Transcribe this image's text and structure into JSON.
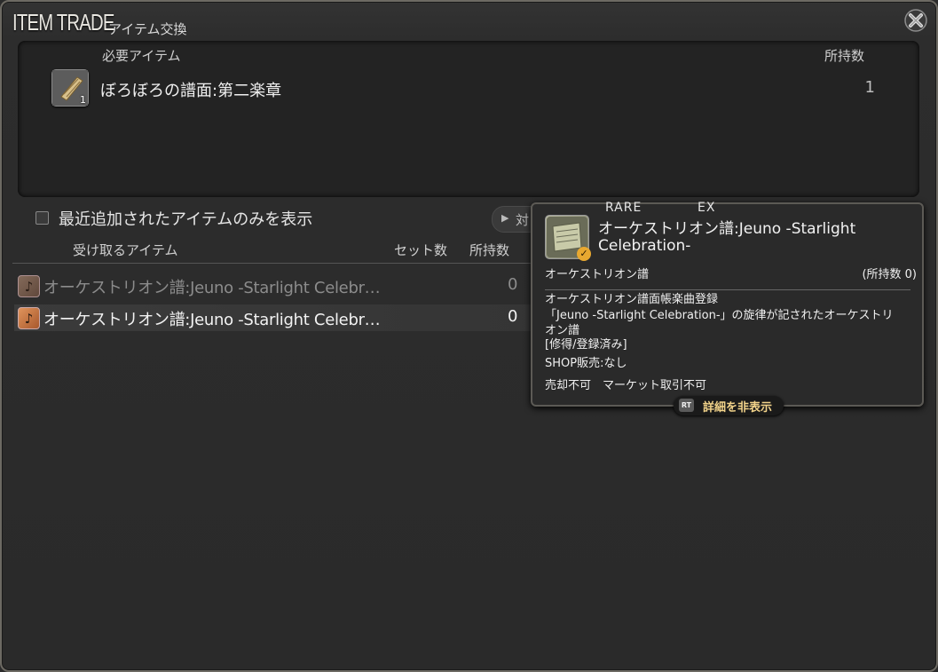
{
  "window": {
    "title": "ITEM TRADE",
    "subtitle": "アイテム交換"
  },
  "required": {
    "header_item": "必要アイテム",
    "header_owned": "所持数",
    "item": {
      "name": "ぼろぼろの譜面:第二楽章",
      "qty": "1",
      "owned": "1",
      "icon": "scroll-icon"
    }
  },
  "filter": {
    "checkbox_label": "最近追加されたアイテムのみを表示",
    "button_label": "対",
    "checked": false
  },
  "list": {
    "header_item": "受け取るアイテム",
    "header_set": "セット数",
    "header_owned": "所持数",
    "rows": [
      {
        "name": "オーケストリオン譜:Jeuno -Starlight Celebr…",
        "owned": "0",
        "icon": "music-note-icon"
      },
      {
        "name": "オーケストリオン譜:Jeuno -Starlight Celebr…",
        "owned": "0",
        "icon": "music-note-icon"
      }
    ]
  },
  "tooltip": {
    "tag_rare": "RARE",
    "tag_ex": "EX",
    "name": "オーケストリオン譜:Jeuno -Starlight Celebration-",
    "category": "オーケストリオン譜",
    "owned": "(所持数 0)",
    "desc_line1": "オーケストリオン譜面帳楽曲登録",
    "desc_line2": "「Jeuno -Starlight Celebration-」の旋律が記されたオーケストリオン譜",
    "desc_line3": "[修得/登録済み]",
    "shop": "SHOP販売:なし",
    "flags": "売却不可　マーケット取引不可",
    "detail_key": "RT",
    "detail_label": "詳細を非表示"
  },
  "colors": {
    "accent_gold": "#f2d38a",
    "icon_orange": "#e0945c"
  }
}
